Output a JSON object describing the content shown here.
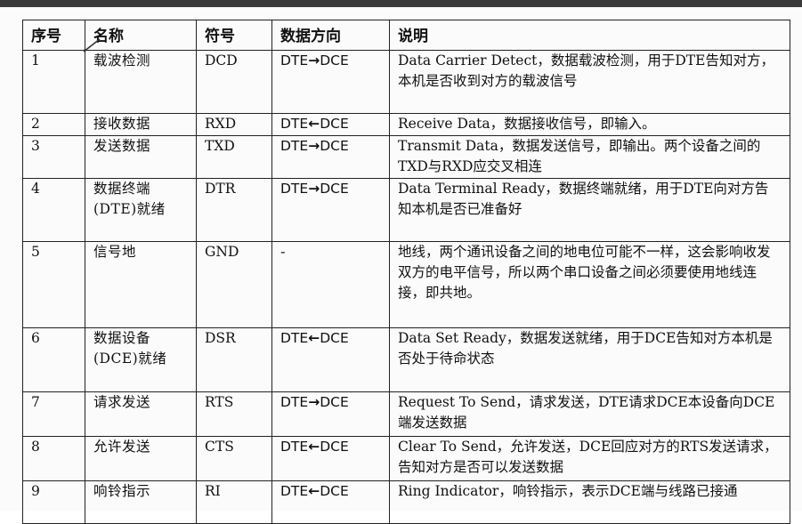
{
  "table": {
    "headers": [
      "序号",
      "名称",
      "符号",
      "数据方向",
      "说明"
    ],
    "rows": [
      {
        "num": "1",
        "name": "载波检测",
        "symbol": "DCD",
        "dir_from": "DTE",
        "dir_arrow": "→",
        "dir_to": "DCE",
        "desc": "Data Carrier Detect，数据载波检测，用于DTE告知对方，本机是否收到对方的载波信号"
      },
      {
        "num": "2",
        "name": "接收数据",
        "symbol": "RXD",
        "dir_from": "DTE",
        "dir_arrow": "←",
        "dir_to": "DCE",
        "desc": "Receive Data，数据接收信号，即输入。"
      },
      {
        "num": "3",
        "name": "发送数据",
        "symbol": "TXD",
        "dir_from": "DTE",
        "dir_arrow": "→",
        "dir_to": "DCE",
        "desc": "Transmit Data，数据发送信号，即输出。两个设备之间的TXD与RXD应交叉相连"
      },
      {
        "num": "4",
        "name": "数据终端(DTE)就绪",
        "symbol": "DTR",
        "dir_from": "DTE",
        "dir_arrow": "→",
        "dir_to": "DCE",
        "desc": "Data Terminal Ready，数据终端就绪，用于DTE向对方告知本机是否已准备好"
      },
      {
        "num": "5",
        "name": "信号地",
        "symbol": "GND",
        "dir_from": "-",
        "dir_arrow": "",
        "dir_to": "",
        "desc": "地线，两个通讯设备之间的地电位可能不一样，这会影响收发双方的电平信号，所以两个串口设备之间必须要使用地线连接，即共地。"
      },
      {
        "num": "6",
        "name": "数据设备(DCE)就绪",
        "symbol": "DSR",
        "dir_from": "DTE",
        "dir_arrow": "←",
        "dir_to": "DCE",
        "desc": "Data Set Ready，数据发送就绪，用于DCE告知对方本机是否处于待命状态"
      },
      {
        "num": "7",
        "name": "请求发送",
        "symbol": "RTS",
        "dir_from": "DTE",
        "dir_arrow": "→",
        "dir_to": "DCE",
        "desc": "Request To Send，请求发送，DTE请求DCE本设备向DCE端发送数据"
      },
      {
        "num": "8",
        "name": "允许发送",
        "symbol": "CTS",
        "dir_from": "DTE",
        "dir_arrow": "←",
        "dir_to": "DCE",
        "desc": "Clear To Send，允许发送，DCE回应对方的RTS发送请求，告知对方是否可以发送数据"
      },
      {
        "num": "9",
        "name": "响铃指示",
        "symbol": "RI",
        "dir_from": "DTE",
        "dir_arrow": "←",
        "dir_to": "DCE",
        "desc": "Ring Indicator，响铃指示，表示DCE端与线路已接通"
      }
    ]
  }
}
